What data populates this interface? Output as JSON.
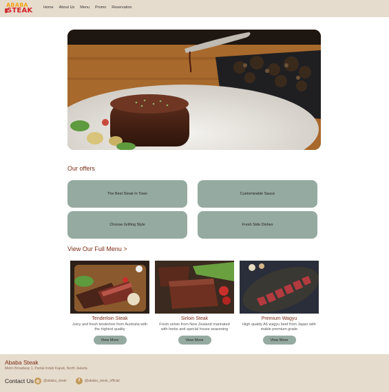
{
  "brand": {
    "logo_top": "ABABA",
    "logo_bottom": "STEAK"
  },
  "nav": {
    "items": [
      "Home",
      "About Us",
      "Menu",
      "Promo",
      "Reservation"
    ]
  },
  "offers": {
    "title": "Our offers",
    "items": [
      "The Best Steak In Town",
      "Customizable Sauce",
      "Choose Grilling Style",
      "Fresh Side Dishes"
    ]
  },
  "menu": {
    "title": "View Our Full Menu >",
    "cards": [
      {
        "title": "Tenderloin Steak",
        "desc": "Juicy and fresh tenderloin from Australia with the highest quality",
        "button": "View More"
      },
      {
        "title": "Sirloin Steak",
        "desc": "Fresh sirloin from New Zealand marinated with herbs and special house seasoning",
        "button": "View More"
      },
      {
        "title": "Premium Wagyu",
        "desc": "High quality A6 wagyu beef from Japan with mable premium grade",
        "button": "View More"
      }
    ]
  },
  "footer": {
    "brand": "Ababa Steak",
    "address": "Metro Broadway 1, Pantai Indah Kapuk, North Jakarta",
    "contact_label": "Contact Us",
    "instagram": "@ababa_steak",
    "facebook": "@ababa_steak_official"
  },
  "colors": {
    "accent": "#95aaa0",
    "title": "#7a2a14",
    "bar": "#e6dccd"
  },
  "icons": {
    "instagram": "instagram-icon",
    "facebook": "facebook-icon"
  }
}
